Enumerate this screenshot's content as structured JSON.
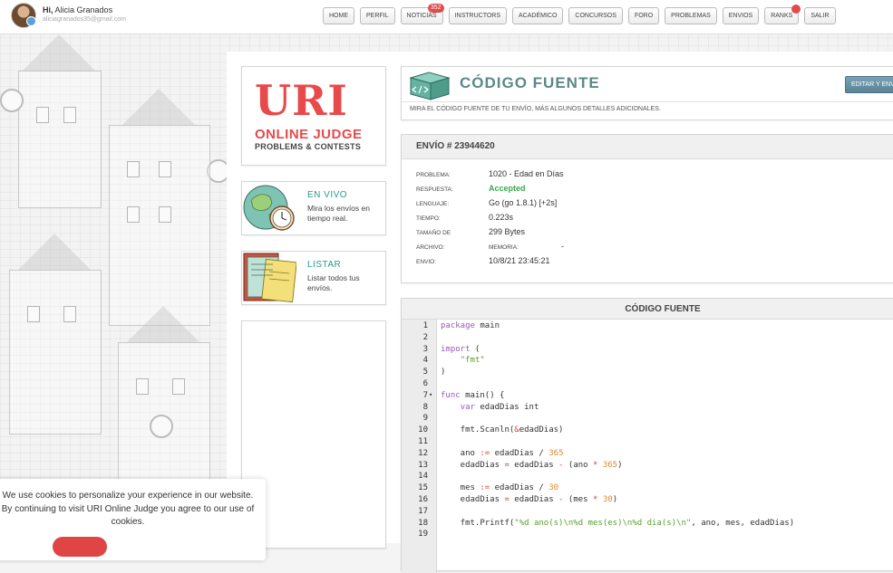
{
  "user": {
    "greeting_prefix": "Hi,",
    "name": "Alicia Granados",
    "email": "aliciagranados35@gmail.com"
  },
  "nav": {
    "items": [
      {
        "label": "HOME"
      },
      {
        "label": "PERFIL"
      },
      {
        "label": "NOTICIAS",
        "badge": "352"
      },
      {
        "label": "INSTRUCTORS"
      },
      {
        "label": "ACADÉMICO"
      },
      {
        "label": "CONCURSOS"
      },
      {
        "label": "FORO"
      },
      {
        "label": "PROBLEMAS"
      },
      {
        "label": "ENVIOS"
      },
      {
        "label": "RANKS"
      },
      {
        "label": "SALIR"
      }
    ]
  },
  "logo": {
    "main": "URI",
    "line2": "ONLINE JUDGE",
    "line3": "PROBLEMS & CONTESTS"
  },
  "side": {
    "live": {
      "title": "EN VIVO",
      "desc": "Mira los envíos en tiempo real."
    },
    "list": {
      "title": "LISTAR",
      "desc": "Listar todos tus envíos."
    }
  },
  "header": {
    "title": "CÓDIGO FUENTE",
    "subtitle": "MIRA EL CÓDIGO FUENTE DE TU ENVÍO, MÁS ALGUNOS DETALLES ADICIONALES.",
    "edit_label": "EDITAR Y ENV"
  },
  "submission": {
    "title": "ENVÍO # 23944620",
    "rows": [
      {
        "label": "PROBLEMA:",
        "value": "1020 - Edad en Días"
      },
      {
        "label": "RESPUESTA:",
        "value": "Accepted"
      },
      {
        "label": "LENGUAJE:",
        "value": "Go (go 1.8.1) [+2s]"
      },
      {
        "label": "TIEMPO:",
        "value": "0.223s"
      },
      {
        "label": "TAMAÑO DE",
        "value": "299 Bytes"
      },
      {
        "label": "ARCHIVO:",
        "label2": "MEMORIA:",
        "value2": "-"
      },
      {
        "label": "ENVIO:",
        "value": "10/8/21 23:45:21"
      }
    ]
  },
  "code": {
    "title": "CÓDIGO FUENTE",
    "line_numbers": [
      "1",
      "2",
      "3",
      "4",
      "5",
      "6",
      "7",
      "8",
      "9",
      "10",
      "11",
      "12",
      "13",
      "14",
      "15",
      "16",
      "17",
      "18",
      "19"
    ],
    "fold_marker": "▾",
    "tokens": {
      "l1": [
        "package",
        " main"
      ],
      "l3": [
        "import",
        " ("
      ],
      "l4": [
        "    ",
        "\"fmt\""
      ],
      "l5": [
        ")"
      ],
      "l7": [
        "func",
        " main() {"
      ],
      "l8": [
        "    ",
        "var",
        " edadDias int"
      ],
      "l10": [
        "    fmt.Scanln(",
        "&",
        "edadDias)"
      ],
      "l12": [
        "    ano ",
        ":=",
        " edadDias / ",
        "365"
      ],
      "l13": [
        "    edadDias ",
        "=",
        " edadDias ",
        "-",
        " (ano ",
        "*",
        " ",
        "365",
        ")"
      ],
      "l15": [
        "    mes ",
        ":=",
        " edadDias / ",
        "30"
      ],
      "l16": [
        "    edadDias ",
        "=",
        " edadDias ",
        "-",
        " (mes ",
        "*",
        " ",
        "30",
        ")"
      ],
      "l18": [
        "    fmt.Printf(",
        "\"%d ano(s)\\n%d mes(es)\\n%d dia(s)\\n\"",
        ", ano, mes, edadDias)"
      ]
    }
  },
  "cookie": {
    "text": "We use cookies to personalize your experience in our website. By continuing to visit URI Online Judge you agree to our use of cookies."
  },
  "colors": {
    "brand_red": "#e8494a",
    "teal": "#2a9a8a",
    "accepted_green": "#3aa84a"
  }
}
